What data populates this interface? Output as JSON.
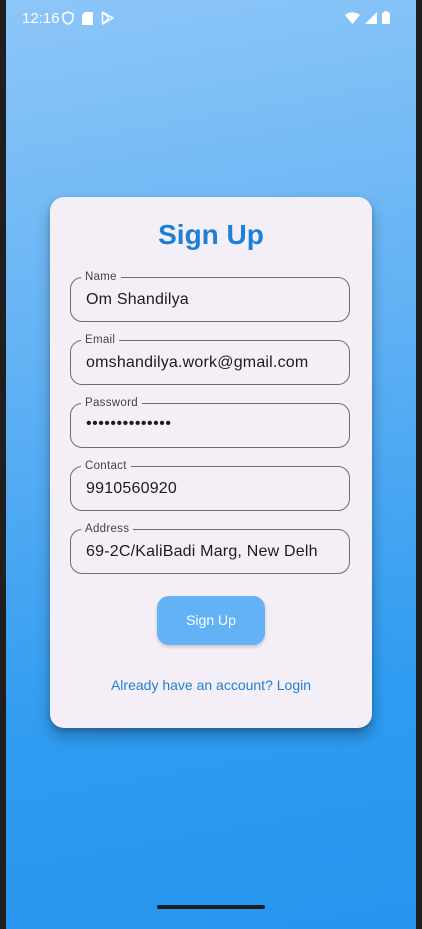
{
  "status_bar": {
    "time": "12:16",
    "left_icons": [
      "shield-icon",
      "sd-card-icon",
      "play-store-icon"
    ],
    "right_icons": [
      "wifi-icon",
      "signal-icon",
      "battery-icon"
    ]
  },
  "form": {
    "title": "Sign Up",
    "fields": [
      {
        "label": "Name",
        "value": "Om Shandilya"
      },
      {
        "label": "Email",
        "value": "omshandilya.work@gmail.com"
      },
      {
        "label": "Password",
        "value": "••••••••••••••"
      },
      {
        "label": "Contact",
        "value": "9910560920"
      },
      {
        "label": "Address",
        "value": "69-2C/KaliBadi Marg, New Delh"
      }
    ],
    "submit_label": "Sign Up",
    "login_link": "Already have an account? Login"
  },
  "colors": {
    "accent": "#1e7fd6",
    "button": "#63b2f5",
    "card": "#f4eff6",
    "background_top": "#8dc6f8",
    "background_bottom": "#2794ee"
  }
}
